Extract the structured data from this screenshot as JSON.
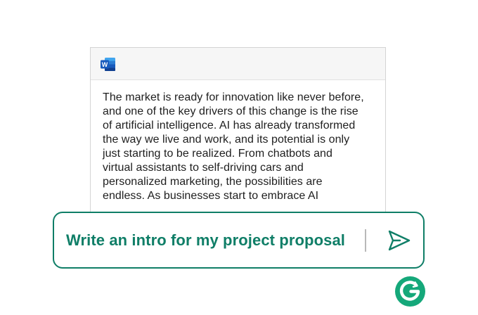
{
  "document": {
    "app_icon": "word-icon",
    "app_icon_letter": "W",
    "lines": [
      "The market is ready for innovation like never before,",
      "and one of the key drivers of this change is the rise",
      "of artificial intelligence. AI has already transformed",
      "the way we live and work, and its potential is only",
      "just starting to be realized. From chatbots and",
      "virtual assistants to self-driving cars and",
      "personalized marketing, the possibilities are",
      "endless. As businesses start to embrace AI"
    ]
  },
  "prompt": {
    "text": "Write an intro for my project proposal",
    "send_icon": "send-icon"
  },
  "brand": {
    "logo_icon": "grammarly-logo-icon",
    "logo_letter": "G"
  },
  "colors": {
    "accent": "#0f7e67",
    "word_blue": "#185abd",
    "text": "#1e1e1e"
  }
}
